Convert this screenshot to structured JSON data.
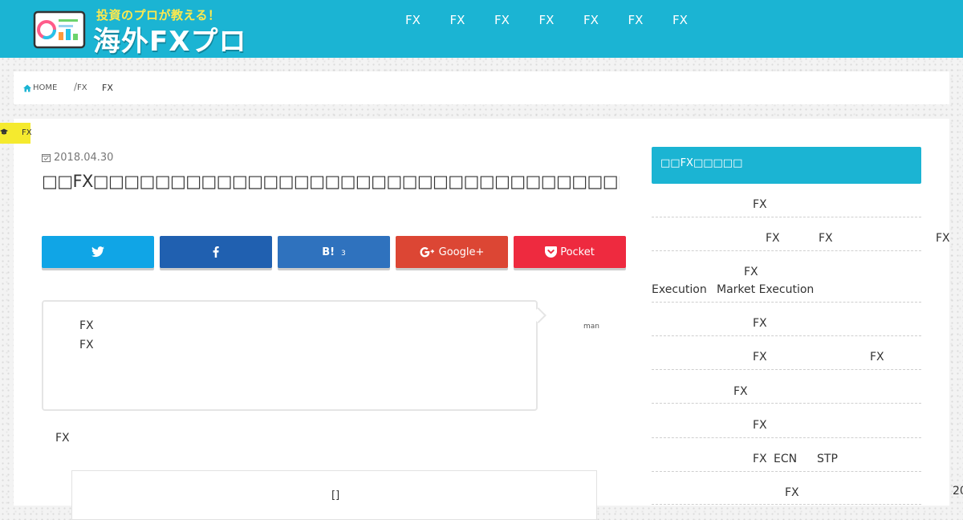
{
  "header": {
    "tagline": "投資のプロが教える！",
    "site_name": "海外FXプロ",
    "nav": [
      "FX",
      "FX",
      "FX",
      "FX",
      "FX",
      "FX",
      "FX"
    ]
  },
  "breadcrumb": {
    "home": "HOME",
    "sep": "/",
    "item1": "FX",
    "item2": "FX"
  },
  "category_badge": "FX",
  "article": {
    "date": "2018.04.30",
    "title": "□□FX□□□□□□□□□□□□□□□□□□□□□□□□□□□□□□□□□□□□□□□□□□□□□□□□□",
    "share": {
      "hatena_label": "B!",
      "hatena_count": "3",
      "google_label": "Google+",
      "pocket_label": "Pocket"
    },
    "bubble_line1": "FX",
    "bubble_line2": "FX",
    "speaker": "man",
    "paragraph": "FX",
    "toc_toggle": "[]"
  },
  "sidebar": {
    "heading": "□□FX□□□□□",
    "items": [
      {
        "t1": "FX"
      },
      {
        "t1": "FX",
        "t2": "FX",
        "t3": "FX"
      },
      {
        "t1": "FX",
        "t2": "Execution",
        "t3": "Market Execution"
      },
      {
        "t1": "FX"
      },
      {
        "t1": "FX",
        "t2": "FX"
      },
      {
        "t1": "FX"
      },
      {
        "t1": "FX"
      },
      {
        "t1": "FX",
        "t2": "ECN",
        "t3": "STP"
      },
      {
        "t1": "FX",
        "t2": "20"
      }
    ]
  },
  "colors": {
    "header_bg": "#1bb4d3",
    "accent_yellow": "#ffe94d",
    "twitter": "#10a5e6",
    "facebook": "#2060b0",
    "hatena": "#2f72be",
    "google": "#dc4634",
    "pocket": "#ee2a3f"
  }
}
